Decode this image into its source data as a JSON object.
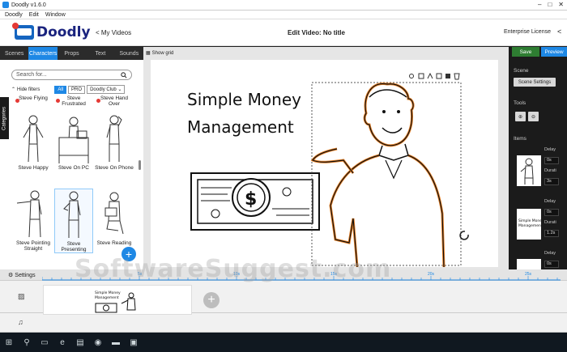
{
  "window": {
    "title": "Doodly v1.6.0",
    "controls": [
      "–",
      "□",
      "✕"
    ]
  },
  "menu": [
    "Doodly",
    "Edit",
    "Window"
  ],
  "header": {
    "brand": "Doodly",
    "my_videos": "< My Videos",
    "edit_title": "Edit Video: No title",
    "license": "Enterprise License",
    "collapse": "<"
  },
  "left": {
    "tabs": [
      "Scenes",
      "Characters",
      "Props",
      "Text",
      "Sounds"
    ],
    "active_tab": "Characters",
    "search_placeholder": "Search for...",
    "hide_filters": "Hide filters",
    "filter_pills": [
      "All",
      "PRO",
      "Doodly Club"
    ],
    "categories_tab": "Categories",
    "characters": [
      {
        "label": "Steve Flying"
      },
      {
        "label": "Steve Frustrated"
      },
      {
        "label": "Steve Hand Over"
      },
      {
        "label": "Steve Happy"
      },
      {
        "label": "Steve On PC"
      },
      {
        "label": "Steve On Phone"
      },
      {
        "label": "Steve Pointing Straight"
      },
      {
        "label": "Steve Presenting"
      },
      {
        "label": "Steve Reading"
      }
    ],
    "fab": "+"
  },
  "stage": {
    "show_grid": "Show grid",
    "text_line1": "Simple Money",
    "text_line2": "Management",
    "toolbar_icons": [
      "gear-icon",
      "copy-icon",
      "flip-icon",
      "front-icon",
      "back-icon",
      "delete-icon"
    ]
  },
  "right": {
    "save": "Save",
    "preview": "Preview",
    "scene_label": "Scene",
    "scene_settings": "Scene Settings",
    "tools_label": "Tools",
    "items_label": "Items",
    "items": [
      {
        "delay_label": "Delay",
        "delay": "0s",
        "duration_label": "Durati",
        "duration": "3s"
      },
      {
        "delay_label": "Delay",
        "delay": "0s",
        "duration_label": "Durati",
        "duration": "1.2s"
      },
      {
        "delay_label": "Delay",
        "delay": "0s"
      }
    ]
  },
  "timeline": {
    "settings": "Settings",
    "ticks": [
      "5s",
      "10s",
      "15s",
      "20s",
      "25s"
    ],
    "clip_text_line1": "Simple Money",
    "clip_text_line2": "Management",
    "add": "+"
  },
  "watermark": "SoftwareSuggest.com",
  "colors": {
    "accent": "#1e88e5",
    "save": "#2e7d32",
    "preview": "#1e88e5"
  }
}
